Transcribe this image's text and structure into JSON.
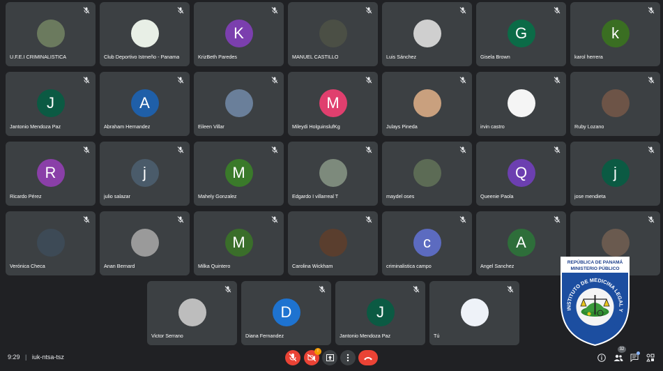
{
  "participants": [
    {
      "name": "U.F.E.I CRIMINALISTICA",
      "initial": "",
      "color": "#6b7a5e"
    },
    {
      "name": "Club Deportivo Istmeño - Panama",
      "initial": "",
      "color": "#e8efe6"
    },
    {
      "name": "KrizBeth Paredes",
      "initial": "K",
      "color": "#7b3fae"
    },
    {
      "name": "MANUEL CASTILLO",
      "initial": "",
      "color": "#4b4f45"
    },
    {
      "name": "Luis Sánchez",
      "initial": "",
      "color": "#cfcfcf"
    },
    {
      "name": "Gisela Brown",
      "initial": "G",
      "color": "#0b6b47"
    },
    {
      "name": "karol herrera",
      "initial": "k",
      "color": "#3a6e22"
    },
    {
      "name": "Jantonio Mendoza Paz",
      "initial": "J",
      "color": "#0b5a43"
    },
    {
      "name": "Abraham Hernandez",
      "initial": "A",
      "color": "#1f5fa8"
    },
    {
      "name": "Eileen Villar",
      "initial": "",
      "color": "#6a7f9a"
    },
    {
      "name": "Mileydi HolguinslufKg",
      "initial": "M",
      "color": "#e03f6e"
    },
    {
      "name": "Julays Pineda",
      "initial": "",
      "color": "#c9a07e"
    },
    {
      "name": "irvin castro",
      "initial": "",
      "color": "#f5f5f5"
    },
    {
      "name": "Ruby Lozano",
      "initial": "",
      "color": "#6d5447"
    },
    {
      "name": "Ricardo Pérez",
      "initial": "R",
      "color": "#8a3fa8"
    },
    {
      "name": "julio salazar",
      "initial": "j",
      "color": "#4a5b6a"
    },
    {
      "name": "Mahely Gonzalez",
      "initial": "M",
      "color": "#3a7a2a"
    },
    {
      "name": "Edgardo I villarreal T",
      "initial": "",
      "color": "#7d8a7c"
    },
    {
      "name": "maydel oses",
      "initial": "",
      "color": "#5c6b55"
    },
    {
      "name": "Queenie Paola",
      "initial": "Q",
      "color": "#6c3fb0"
    },
    {
      "name": "jose mendieta",
      "initial": "j",
      "color": "#0b5a43"
    },
    {
      "name": "Verónica Checa",
      "initial": "",
      "color": "#3d4a56"
    },
    {
      "name": "Anan Bernard",
      "initial": "",
      "color": "#9a9a9a"
    },
    {
      "name": "Milka Quintero",
      "initial": "M",
      "color": "#3a6e2a"
    },
    {
      "name": "Carolina Wickham",
      "initial": "",
      "color": "#5a3e2e"
    },
    {
      "name": "criminalistica campo",
      "initial": "c",
      "color": "#5c6bc0"
    },
    {
      "name": "Angel Sanchez",
      "initial": "A",
      "color": "#2e6e3a"
    },
    {
      "name": "",
      "initial": "",
      "color": "#6a5a4f"
    },
    {
      "name": "Victor Serrano",
      "initial": "",
      "color": "#bdbdbd"
    },
    {
      "name": "Diana Fernandez",
      "initial": "D",
      "color": "#1e73d0"
    },
    {
      "name": "Jantonio Mendoza Paz",
      "initial": "J",
      "color": "#0b5a43"
    },
    {
      "name": "Tú",
      "initial": "",
      "color": "#eef2f8"
    }
  ],
  "bottom_bar": {
    "time": "9:29",
    "separator": "|",
    "meeting_code": "iuk-ntsa-tsz",
    "present_badge": "!",
    "people_count": "32"
  },
  "logo": {
    "top_line1": "REPÚBLICA DE PANAMÁ",
    "top_line2": "MINISTERIO PÚBLICO",
    "ring_text": "INSTITUTO DE MEDICINA LEGAL Y CIENCIAS FORENSES"
  },
  "colors": {
    "end_call": "#ea4335",
    "mic_off": "#ea4335",
    "tile": "#3c4043",
    "bg": "#202124",
    "badge": "#f29900"
  }
}
